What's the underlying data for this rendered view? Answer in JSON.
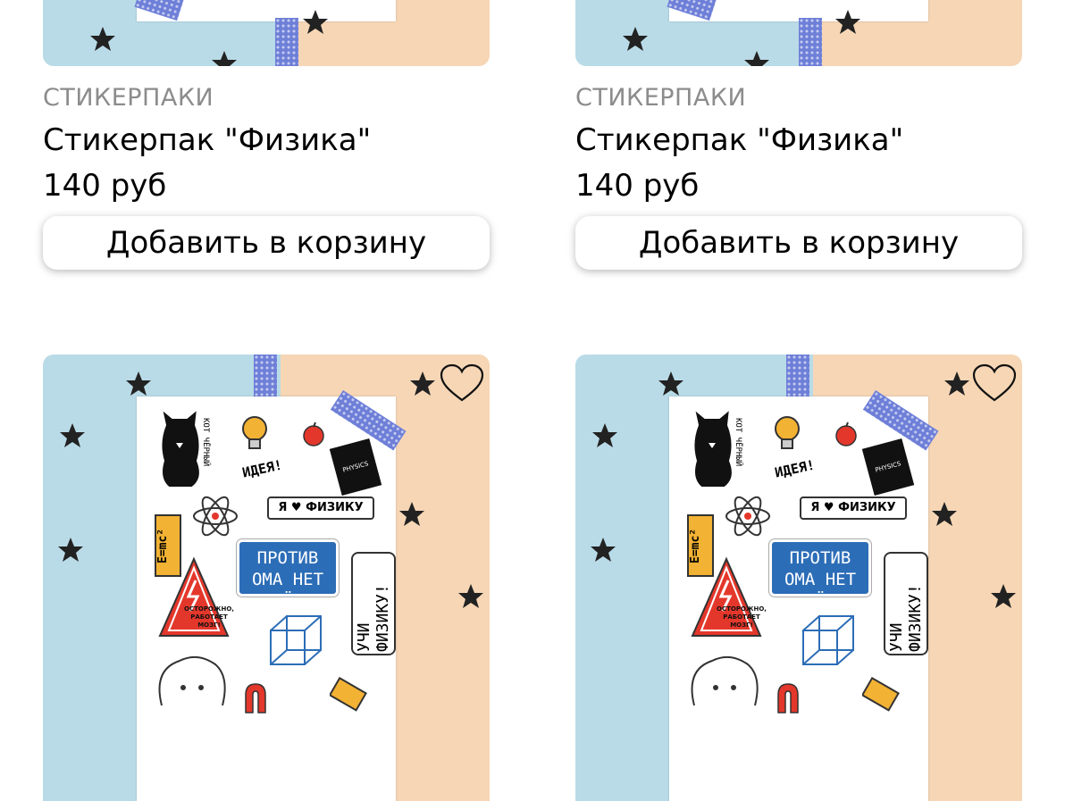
{
  "products": [
    {
      "category": "СТИКЕРПАКИ",
      "title": "Стикерпак \"Физика\"",
      "price": "140 руб",
      "button_label": "Добавить в корзину"
    },
    {
      "category": "СТИКЕРПАКИ",
      "title": "Стикерпак \"Физика\"",
      "price": "140 руб",
      "button_label": "Добавить в корзину"
    },
    {
      "image_text": {
        "cat": "КОТ ЧЁРНЫЙ",
        "idea": "ИДЕЯ!",
        "physics_book": "PHYSICS",
        "love_physics": "Я ♥ ФИЗИКУ",
        "emc": "E=mc²",
        "ohm": "ПРОТИВ ОМА НЕТ ПРИЁМА!",
        "learn": "УЧИ ФИЗИКУ!",
        "warning": "ОСТОРОЖНО, РАБОТАЕТ МОЗГ!"
      }
    },
    {
      "image_text": {
        "cat": "КОТ ЧЁРНЫЙ",
        "idea": "ИДЕЯ!",
        "physics_book": "PHYSICS",
        "love_physics": "Я ♥ ФИЗИКУ",
        "emc": "E=mc²",
        "ohm": "ПРОТИВ ОМА НЕТ ПРИЁМА!",
        "learn": "УЧИ ФИЗИКУ!",
        "warning": "ОСТОРОЖНО, РАБОТАЕТ МОЗГ!"
      }
    }
  ],
  "icons": {
    "favorite": "heart-outline-icon",
    "decor": "star-icon"
  },
  "colors": {
    "bg_blue": "#b9dbe7",
    "bg_peach": "#f6d6b5",
    "tape": "#6e7fd8",
    "sticker_blue": "#2c6db7",
    "sticker_red": "#e4372b",
    "category_gray": "#8c8c8c"
  }
}
